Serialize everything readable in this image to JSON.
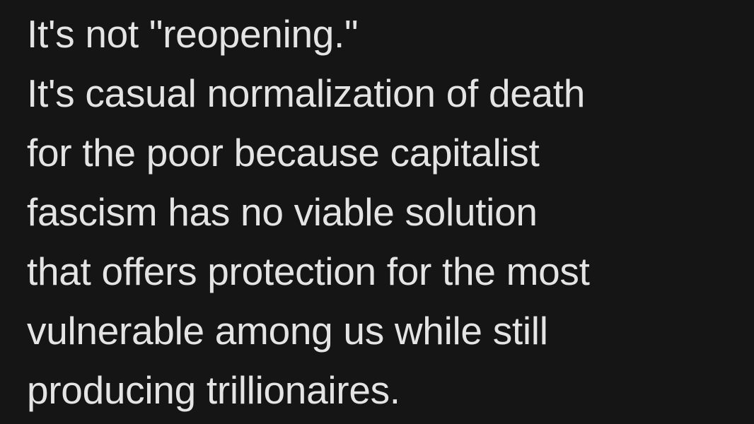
{
  "post": {
    "lines": [
      "It's not \"reopening.\"",
      "It's casual normalization of death",
      "for the poor because capitalist",
      "fascism has no viable solution",
      "that offers protection for the most",
      "vulnerable among us while still",
      "producing trillionaires."
    ]
  },
  "colors": {
    "background": "#141514",
    "text": "#e4e4e4"
  }
}
